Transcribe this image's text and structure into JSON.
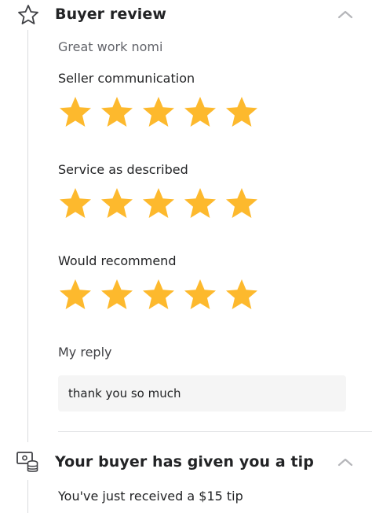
{
  "review": {
    "title": "Buyer review",
    "comment": "Great work nomi",
    "ratings": [
      {
        "label": "Seller communication",
        "stars": 5,
        "max": 5
      },
      {
        "label": "Service as described",
        "stars": 5,
        "max": 5
      },
      {
        "label": "Would recommend",
        "stars": 5,
        "max": 5
      }
    ],
    "reply_label": "My reply",
    "reply_text": "thank you so much",
    "icon": "star-outline-icon",
    "collapse_icon": "chevron-up-icon"
  },
  "tip": {
    "title": "Your buyer has given you a tip",
    "description": "You've just received a $15 tip",
    "icon": "money-tip-icon",
    "collapse_icon": "chevron-up-icon"
  },
  "colors": {
    "star": "#FDB92D",
    "text": "#222325",
    "muted": "#62646a",
    "reply_bg": "#f5f5f5"
  }
}
